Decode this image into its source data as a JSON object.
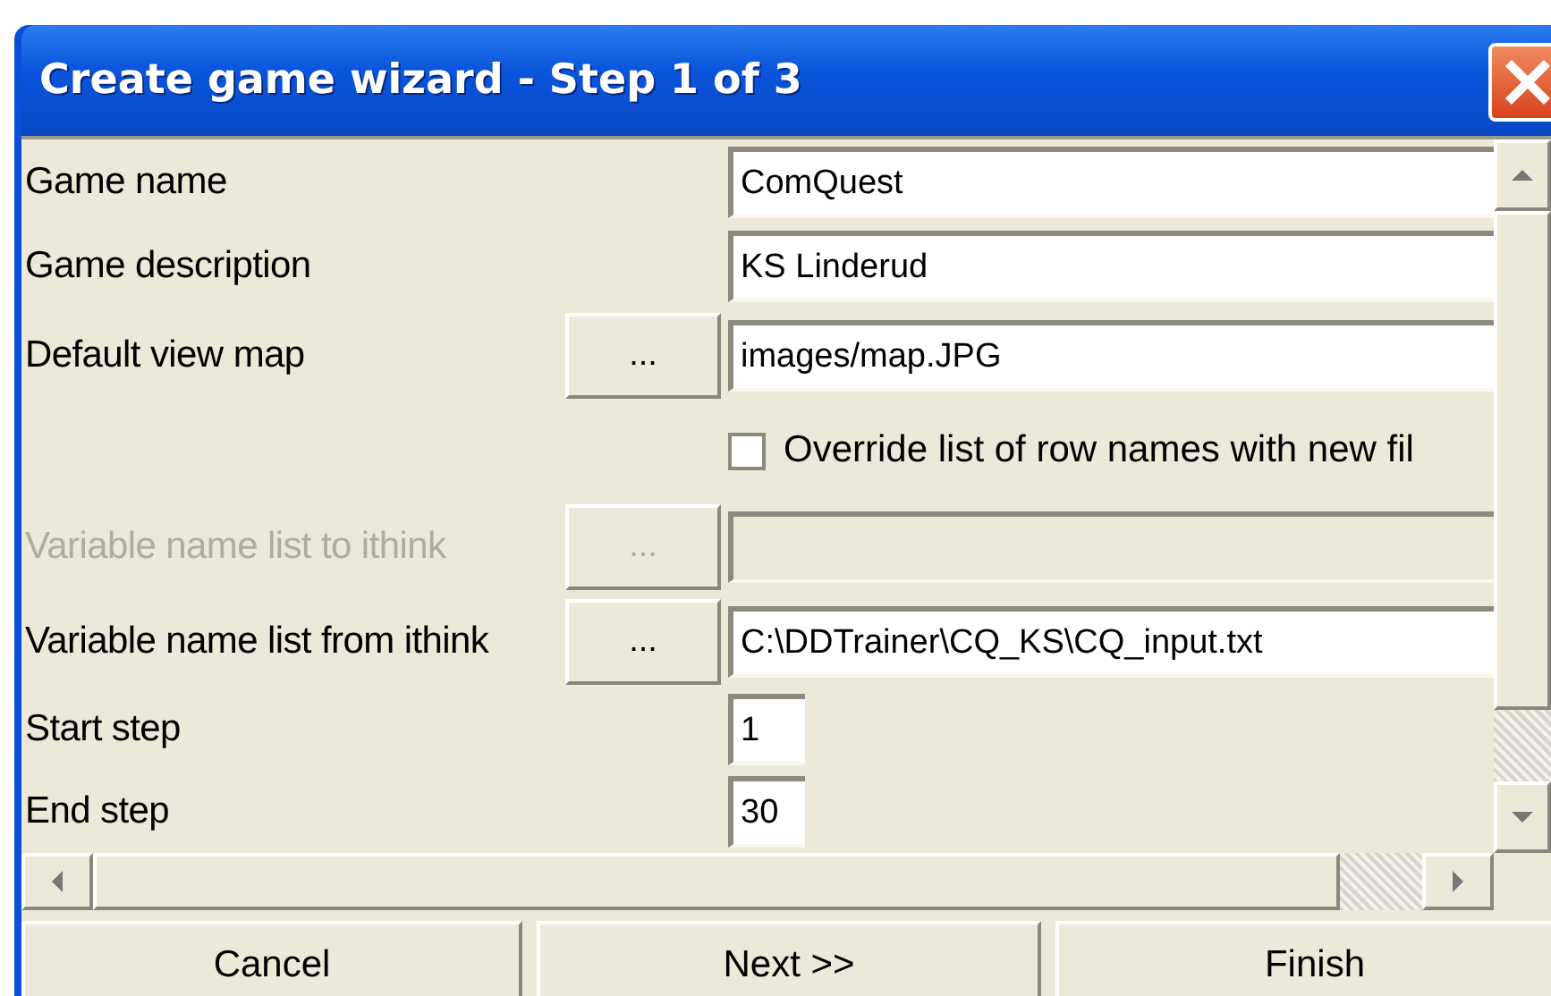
{
  "window": {
    "title": "Create game wizard - Step 1 of 3"
  },
  "fields": [
    {
      "kind": "text",
      "label": "Game name",
      "value": "ComQuest",
      "disabled": false
    },
    {
      "kind": "text",
      "label": "Game description",
      "value": "KS Linderud",
      "disabled": false
    },
    {
      "kind": "file",
      "label": "Default view map",
      "button": "...",
      "value": "images/map.JPG",
      "disabled": false
    },
    {
      "kind": "checkbox",
      "label": "Override list of row names with new fil",
      "checked": false
    },
    {
      "kind": "file",
      "label": "Variable name list to ithink",
      "button": "...",
      "disabled": true
    },
    {
      "kind": "file",
      "label": "Variable name list from ithink",
      "button": "...",
      "value": "C:\\DDTrainer\\CQ_KS\\CQ_input.txt",
      "disabled": false
    },
    {
      "kind": "number",
      "label": "Start step",
      "value": "1",
      "disabled": false
    },
    {
      "kind": "number",
      "label": "End step",
      "value": "30",
      "disabled": false
    }
  ],
  "buttons": [
    "Cancel",
    "Next >>",
    "Finish"
  ]
}
